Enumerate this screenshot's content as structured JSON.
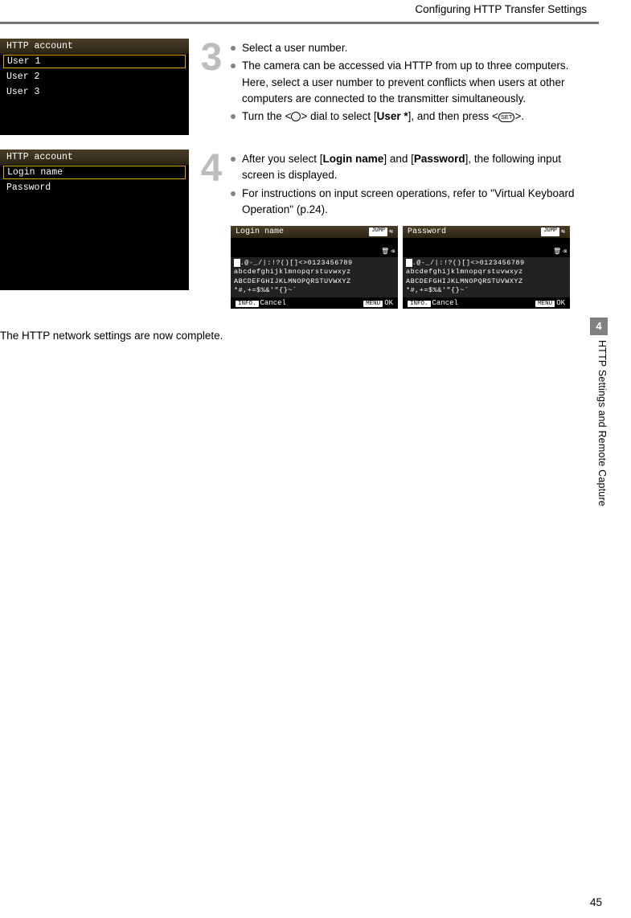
{
  "header": {
    "title": "Configuring HTTP Transfer Settings"
  },
  "page_number": "45",
  "side_tab": {
    "chapter": "4",
    "label": "HTTP Settings and Remote Capture"
  },
  "screenshot3": {
    "title": "HTTP account",
    "items": [
      "User 1",
      "User 2",
      "User 3"
    ]
  },
  "screenshot4": {
    "title": "HTTP account",
    "items": [
      "Login name",
      "Password"
    ]
  },
  "step3": {
    "num": "3",
    "b1": "Select a user number.",
    "b2": "The camera can be accessed via HTTP from up to three computers. Here, select a user number to prevent conflicts when users at other computers are connected to the transmitter simultaneously.",
    "b3a": "Turn the <",
    "b3b": "> dial to select [",
    "b3_user": "User *",
    "b3c": "], and then press <",
    "b3d": ">.",
    "set_label": "SET"
  },
  "step4": {
    "num": "4",
    "b1a": "After you select [",
    "b1_login": "Login name",
    "b1b": "] and [",
    "b1_pw": "Password",
    "b1c": "], the following input screen is displayed.",
    "b2": "For instructions on input screen operations, refer to \"Virtual Keyboard Operation\" (p.24)."
  },
  "vk": {
    "left_title": "Login name",
    "right_title": "Password",
    "jump": "JUMP",
    "line1": ".@-_/|:!?()[]<>0123456789",
    "line2": "abcdefghijklmnopqrstuvwxyz",
    "line3": "ABCDEFGHIJKLMNOPQRSTUVWXYZ",
    "line4": "*#,+=$%&'\"{}~`",
    "info": "INFO.",
    "cancel": "Cancel",
    "menu": "MENU",
    "ok": "OK"
  },
  "complete": "The HTTP network settings are now complete."
}
